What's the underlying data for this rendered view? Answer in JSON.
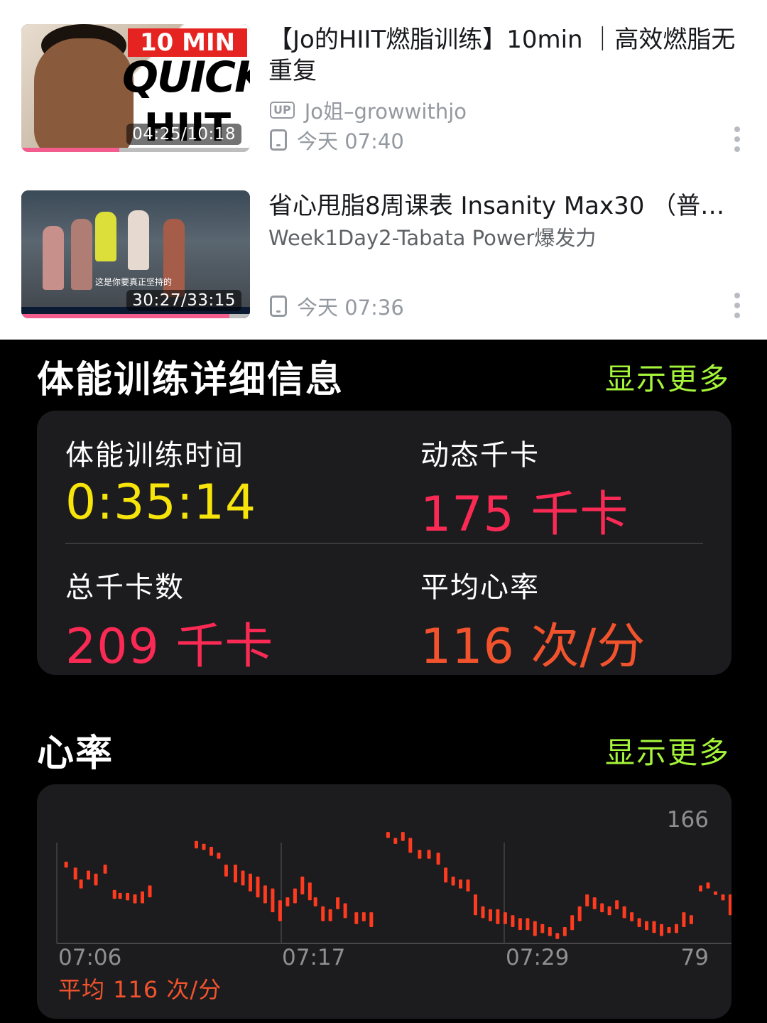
{
  "history": {
    "videos": [
      {
        "title": "【Jo的HIIT燃脂训练】10min ｜高效燃脂无重复",
        "uploader_badge": "UP",
        "uploader": "Jo姐–growwithjo",
        "watched_time": "今天 07:40",
        "duration": "04:25/10:18",
        "progress": 0.43,
        "thumb_text": {
          "line1": "10 MIN",
          "line2": "QUICK",
          "line3": "HIIT"
        }
      },
      {
        "title": "省心甩脂8周课表 Insanity Max30 （普…",
        "subtitle": "Week1Day2-Tabata Power爆发力",
        "watched_time": "今天 07:36",
        "duration": "30:27/33:15",
        "progress": 0.91,
        "thumb_caption": "这是你要真正坚持的"
      }
    ]
  },
  "workout": {
    "title": "体能训练详细信息",
    "show_more": "显示更多",
    "stats": [
      {
        "label": "体能训练时间",
        "value": "0:35:14",
        "color": "#f6e40b"
      },
      {
        "label": "动态千卡",
        "value": "175 千卡",
        "color": "#fa2a55"
      },
      {
        "label": "总千卡数",
        "value": "209 千卡",
        "color": "#fa2a55"
      },
      {
        "label": "平均心率",
        "value": "116 次/分",
        "color": "#f2532d"
      }
    ]
  },
  "heart_rate": {
    "title": "心率",
    "show_more": "显示更多",
    "average_label": "平均 116 次/分",
    "chart_data": {
      "type": "bar",
      "ymax_label": "166",
      "ymin_label": "79",
      "ylim": [
        79,
        166
      ],
      "x_ticks": [
        "07:06",
        "07:17",
        "07:29"
      ],
      "x_range_minutes": [
        0,
        35
      ],
      "bars": [
        [
          0.5,
          130,
          134
        ],
        [
          1.0,
          122,
          130
        ],
        [
          1.3,
          116,
          122
        ],
        [
          1.7,
          122,
          128
        ],
        [
          2.1,
          118,
          126
        ],
        [
          2.6,
          126,
          132
        ],
        [
          3.1,
          109,
          115
        ],
        [
          3.4,
          109,
          113
        ],
        [
          3.8,
          108,
          113
        ],
        [
          4.2,
          106,
          112
        ],
        [
          4.6,
          106,
          114
        ],
        [
          5.0,
          110,
          118
        ],
        [
          7.5,
          143,
          148
        ],
        [
          7.9,
          142,
          146
        ],
        [
          8.3,
          138,
          144
        ],
        [
          8.7,
          136,
          140
        ],
        [
          9.1,
          124,
          132
        ],
        [
          9.6,
          120,
          132
        ],
        [
          10.0,
          118,
          128
        ],
        [
          10.4,
          114,
          126
        ],
        [
          10.8,
          110,
          124
        ],
        [
          11.2,
          106,
          118
        ],
        [
          11.6,
          100,
          116
        ],
        [
          12.0,
          94,
          108
        ],
        [
          12.4,
          104,
          110
        ],
        [
          12.8,
          106,
          116
        ],
        [
          13.2,
          112,
          124
        ],
        [
          13.6,
          108,
          120
        ],
        [
          13.9,
          104,
          110
        ],
        [
          14.3,
          94,
          104
        ],
        [
          14.7,
          94,
          102
        ],
        [
          15.1,
          102,
          110
        ],
        [
          15.5,
          96,
          106
        ],
        [
          16.1,
          92,
          100
        ],
        [
          16.5,
          94,
          100
        ],
        [
          16.9,
          90,
          100
        ],
        [
          17.8,
          150,
          154
        ],
        [
          18.2,
          146,
          150
        ],
        [
          18.6,
          148,
          154
        ],
        [
          19.0,
          140,
          150
        ],
        [
          19.5,
          136,
          142
        ],
        [
          20.0,
          136,
          142
        ],
        [
          20.5,
          132,
          140
        ],
        [
          20.9,
          120,
          130
        ],
        [
          21.3,
          118,
          124
        ],
        [
          21.7,
          116,
          122
        ],
        [
          22.1,
          114,
          122
        ],
        [
          22.5,
          98,
          112
        ],
        [
          22.9,
          96,
          104
        ],
        [
          23.3,
          94,
          102
        ],
        [
          23.7,
          92,
          102
        ],
        [
          24.1,
          92,
          100
        ],
        [
          24.5,
          90,
          98
        ],
        [
          24.9,
          88,
          96
        ],
        [
          25.3,
          88,
          96
        ],
        [
          25.7,
          84,
          94
        ],
        [
          26.1,
          86,
          92
        ],
        [
          26.5,
          84,
          90
        ],
        [
          26.9,
          82,
          86
        ],
        [
          27.3,
          84,
          90
        ],
        [
          27.7,
          88,
          98
        ],
        [
          28.1,
          94,
          104
        ],
        [
          28.5,
          104,
          112
        ],
        [
          28.9,
          102,
          110
        ],
        [
          29.3,
          100,
          106
        ],
        [
          29.7,
          98,
          104
        ],
        [
          30.1,
          102,
          108
        ],
        [
          30.5,
          96,
          104
        ],
        [
          30.9,
          94,
          100
        ],
        [
          31.3,
          90,
          96
        ],
        [
          31.7,
          88,
          94
        ],
        [
          32.1,
          86,
          94
        ],
        [
          32.5,
          84,
          92
        ],
        [
          32.9,
          86,
          90
        ],
        [
          33.3,
          86,
          92
        ],
        [
          33.7,
          90,
          100
        ],
        [
          34.1,
          92,
          98
        ],
        [
          34.6,
          114,
          118
        ],
        [
          35.0,
          116,
          120
        ],
        [
          35.4,
          112,
          114
        ],
        [
          35.8,
          108,
          112
        ],
        [
          36.2,
          98,
          112
        ],
        [
          36.6,
          118,
          126
        ],
        [
          37.0,
          128,
          134
        ],
        [
          37.5,
          110,
          112
        ]
      ]
    }
  }
}
